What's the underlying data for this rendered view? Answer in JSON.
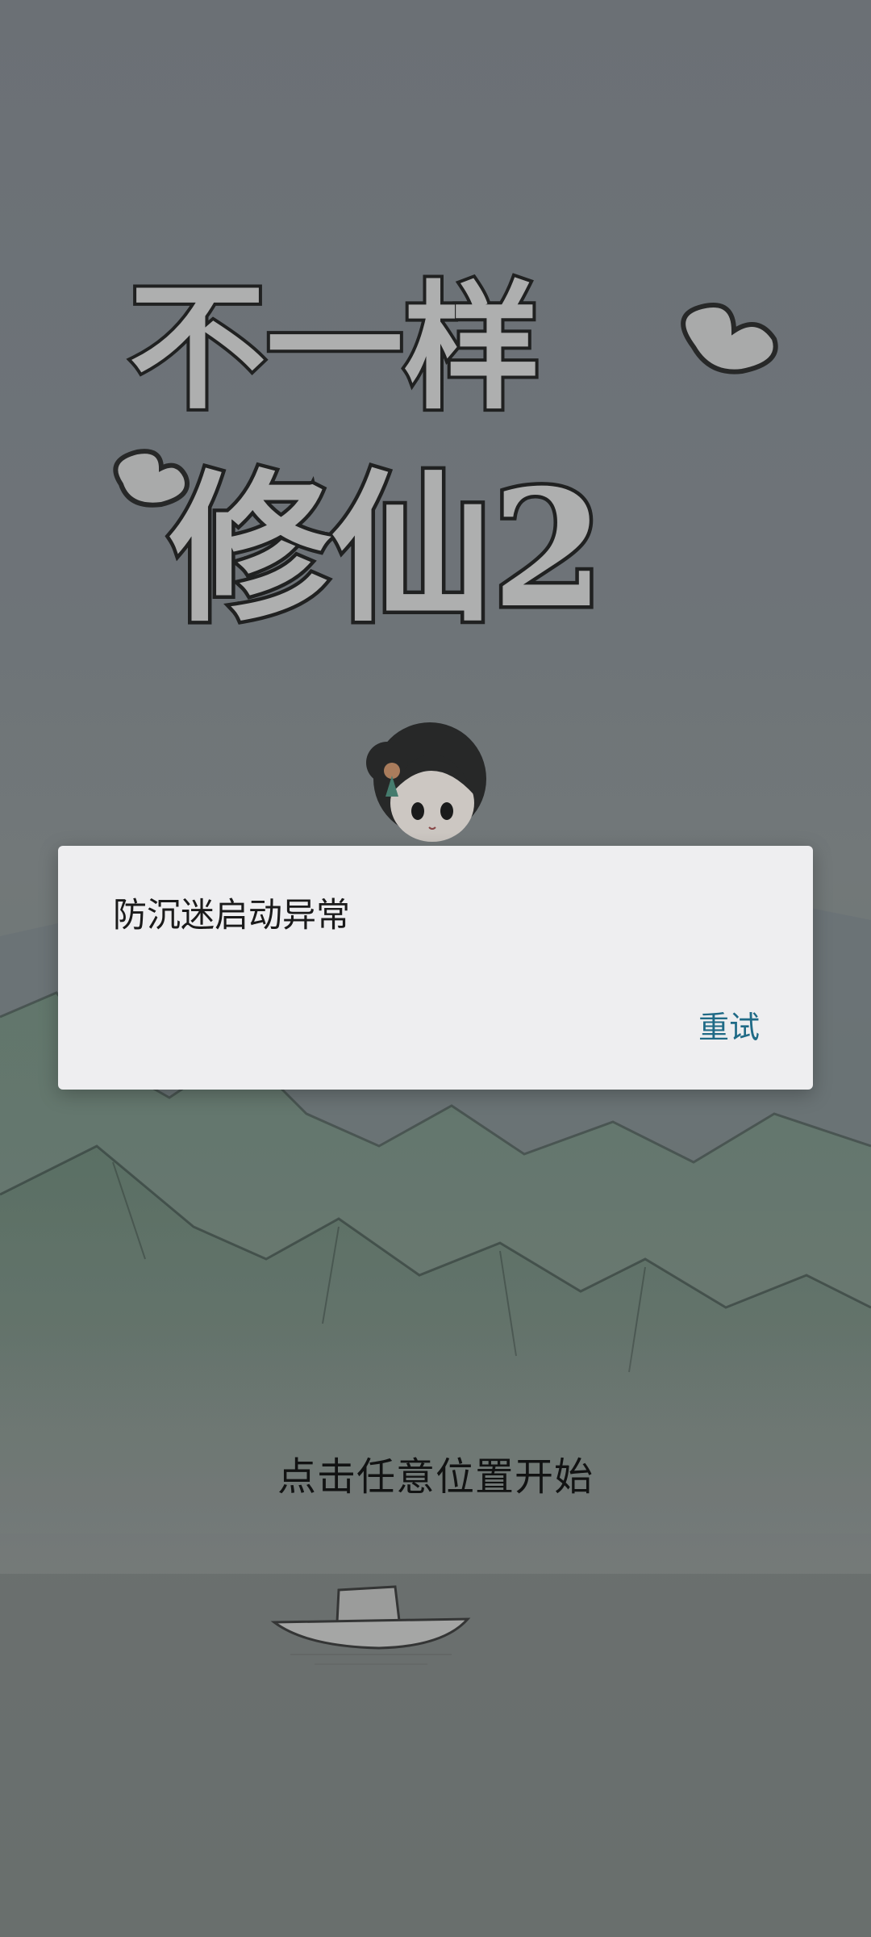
{
  "game": {
    "title_line1": "不一样",
    "title_line2": "修仙2",
    "tap_hint": "点击任意位置开始"
  },
  "dialog": {
    "message": "防沉迷启动异常",
    "retry_label": "重试",
    "accent_color": "#1f6a86"
  },
  "icons": {
    "character": "chibi-cultivator-illustration",
    "boat": "boat-illustration",
    "clouds": "ink-cloud-ornament"
  }
}
